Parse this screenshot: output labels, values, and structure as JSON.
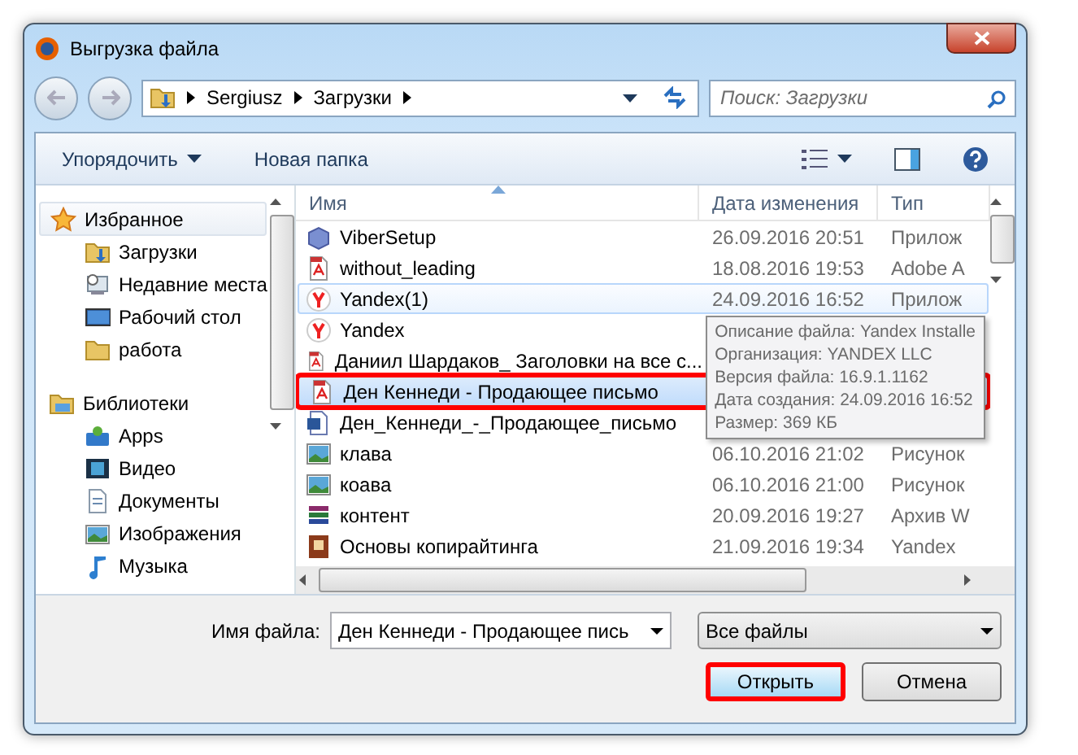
{
  "window": {
    "title": "Выгрузка файла"
  },
  "address": {
    "crumbs": [
      "Sergiusz",
      "Загрузки"
    ]
  },
  "search": {
    "placeholder": "Поиск: Загрузки"
  },
  "toolbar": {
    "organize": "Упорядочить",
    "new_folder": "Новая папка"
  },
  "sidebar": {
    "groups": [
      {
        "label": "Избранное",
        "kind": "favorites",
        "hovered": true,
        "children": [
          {
            "label": "Загрузки",
            "kind": "downloads"
          },
          {
            "label": "Недавние места",
            "kind": "recent"
          },
          {
            "label": "Рабочий стол",
            "kind": "desktop"
          },
          {
            "label": "работа",
            "kind": "folder"
          }
        ]
      },
      {
        "label": "Библиотеки",
        "kind": "libraries",
        "hovered": false,
        "children": [
          {
            "label": "Apps",
            "kind": "apps"
          },
          {
            "label": "Видео",
            "kind": "video"
          },
          {
            "label": "Документы",
            "kind": "documents"
          },
          {
            "label": "Изображения",
            "kind": "pictures"
          },
          {
            "label": "Музыка",
            "kind": "music"
          }
        ]
      }
    ]
  },
  "table": {
    "columns": [
      "Имя",
      "Дата изменения",
      "Тип"
    ],
    "rows": [
      {
        "name": "ViberSetup",
        "date": "26.09.2016 20:51",
        "type": "Прилож",
        "kind": "app",
        "selected": false,
        "hovered": false,
        "highlighted": false
      },
      {
        "name": "without_leading",
        "date": "18.08.2016 19:53",
        "type": "Adobe A",
        "kind": "pdf",
        "selected": false,
        "hovered": false,
        "highlighted": false
      },
      {
        "name": "Yandex(1)",
        "date": "24.09.2016 16:52",
        "type": "Прилож",
        "kind": "yandex",
        "selected": false,
        "hovered": true,
        "highlighted": false
      },
      {
        "name": "Yandex",
        "kind": "yandex",
        "selected": false,
        "hovered": false,
        "highlighted": false
      },
      {
        "name": "Даниил Шардаков_ Заголовки на все с...",
        "kind": "pdf",
        "selected": false,
        "hovered": false,
        "highlighted": false
      },
      {
        "name": "Ден Кеннеди - Продающее письмо",
        "kind": "pdf",
        "selected": true,
        "hovered": false,
        "highlighted": true
      },
      {
        "name": "Ден_Кеннеди_-_Продающее_письмо",
        "kind": "word",
        "selected": false,
        "hovered": false,
        "highlighted": false
      },
      {
        "name": "клава",
        "date": "06.10.2016 21:02",
        "type": "Рисунок",
        "kind": "image",
        "selected": false,
        "hovered": false,
        "highlighted": false
      },
      {
        "name": "коава",
        "date": "06.10.2016 21:00",
        "type": "Рисунок",
        "kind": "image",
        "selected": false,
        "hovered": false,
        "highlighted": false
      },
      {
        "name": "контент",
        "date": "20.09.2016 19:27",
        "type": "Архив W",
        "kind": "archive",
        "selected": false,
        "hovered": false,
        "highlighted": false
      },
      {
        "name": "Основы копирайтинга",
        "date": "21.09.2016 19:34",
        "type": "Yandex",
        "kind": "book",
        "selected": false,
        "hovered": false,
        "highlighted": false
      }
    ]
  },
  "tooltip": {
    "lines": [
      "Описание файла: Yandex Installe",
      "Организация: YANDEX LLC",
      "Версия файла: 16.9.1.1162",
      "Дата создания: 24.09.2016 16:52",
      "Размер: 369 КБ"
    ]
  },
  "footer": {
    "filename_label": "Имя файла:",
    "filename": "Ден Кеннеди - Продающее пись",
    "filter": "Все файлы",
    "buttons": [
      {
        "label": "Открыть",
        "default": true,
        "highlighted": true
      },
      {
        "label": "Отмена",
        "default": false,
        "highlighted": false
      }
    ]
  }
}
